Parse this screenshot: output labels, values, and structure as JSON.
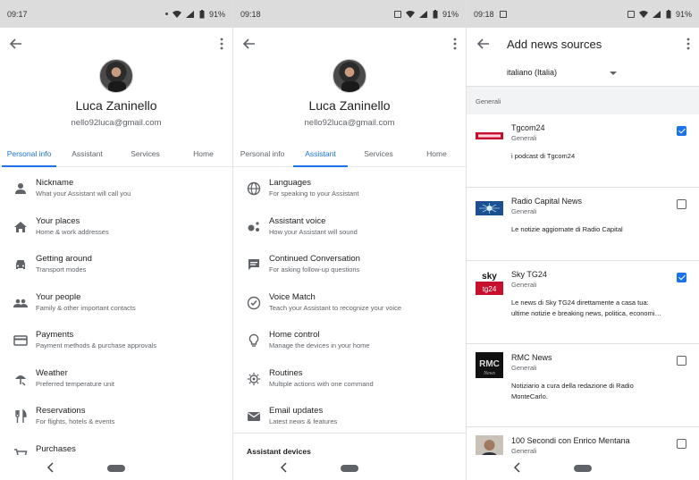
{
  "colors": {
    "accent": "#1a73e8",
    "statusbar": "#dcdcdc",
    "divider": "#e0e0e0",
    "secondary_text": "#5f6368"
  },
  "screens": [
    {
      "status": {
        "time": "09:17",
        "battery": "91%"
      },
      "profile": {
        "name": "Luca Zaninello",
        "email": "nello92luca@gmail.com"
      },
      "tabs": [
        "Personal info",
        "Assistant",
        "Services",
        "Home"
      ],
      "active_tab": "Personal info",
      "items": [
        {
          "icon": "person-icon",
          "title": "Nickname",
          "subtitle": "What your Assistant will call you"
        },
        {
          "icon": "home-icon",
          "title": "Your places",
          "subtitle": "Home & work addresses"
        },
        {
          "icon": "car-icon",
          "title": "Getting around",
          "subtitle": "Transport modes"
        },
        {
          "icon": "people-icon",
          "title": "Your people",
          "subtitle": "Family & other important contacts"
        },
        {
          "icon": "credit-card-icon",
          "title": "Payments",
          "subtitle": "Payment methods & purchase approvals"
        },
        {
          "icon": "weather-icon",
          "title": "Weather",
          "subtitle": "Preferred temperature unit"
        },
        {
          "icon": "restaurant-icon",
          "title": "Reservations",
          "subtitle": "For flights, hotels & events"
        },
        {
          "icon": "cart-icon",
          "title": "Purchases",
          "subtitle": ""
        }
      ]
    },
    {
      "status": {
        "time": "09:18",
        "battery": "91%"
      },
      "profile": {
        "name": "Luca Zaninello",
        "email": "nello92luca@gmail.com"
      },
      "tabs": [
        "Personal info",
        "Assistant",
        "Services",
        "Home"
      ],
      "active_tab": "Assistant",
      "items": [
        {
          "icon": "globe-icon",
          "title": "Languages",
          "subtitle": "For speaking to your Assistant"
        },
        {
          "icon": "assistant-icon",
          "title": "Assistant voice",
          "subtitle": "How your Assistant will sound"
        },
        {
          "icon": "chat-icon",
          "title": "Continued Conversation",
          "subtitle": "For asking follow-up questions"
        },
        {
          "icon": "voice-match-icon",
          "title": "Voice Match",
          "subtitle": "Teach your Assistant to recognize your voice"
        },
        {
          "icon": "lightbulb-icon",
          "title": "Home control",
          "subtitle": "Manage the devices in your home"
        },
        {
          "icon": "routines-icon",
          "title": "Routines",
          "subtitle": "Multiple actions with one command"
        },
        {
          "icon": "email-icon",
          "title": "Email updates",
          "subtitle": "Latest news & features"
        }
      ],
      "section": "Assistant devices"
    },
    {
      "status": {
        "time": "09:18",
        "battery": "91%"
      },
      "title": "Add news sources",
      "language": "italiano (Italia)",
      "group": "Generali",
      "sources": [
        {
          "logo": "tgcom24-logo",
          "name": "Tgcom24",
          "category": "Generali",
          "description": "i podcast di Tgcom24",
          "checked": true
        },
        {
          "logo": "radio-capital-logo",
          "name": "Radio Capital News",
          "category": "Generali",
          "description": "Le notizie aggiornate di Radio Capital",
          "checked": false
        },
        {
          "logo": "sky-tg24-logo",
          "name": "Sky TG24",
          "category": "Generali",
          "description": "Le news di Sky TG24 direttamente a casa tua: ultime notizie e breaking news, politica, economi…",
          "checked": true
        },
        {
          "logo": "rmc-news-logo",
          "name": "RMC News",
          "category": "Generali",
          "description": "Notiziario a cura della redazione di Radio MonteCarlo.",
          "checked": false
        },
        {
          "logo": "mentana-logo",
          "name": "100 Secondi con Enrico Mentana",
          "category": "Generali",
          "description": "",
          "checked": false
        }
      ]
    }
  ]
}
